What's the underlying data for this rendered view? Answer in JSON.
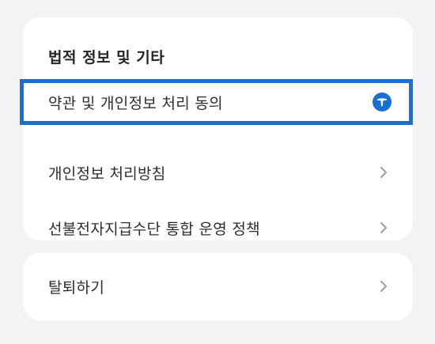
{
  "section": {
    "title": "법적 정보 및 기타"
  },
  "items": [
    {
      "label": "약관 및 개인정보 처리 동의",
      "icon": "toss-logo-icon"
    },
    {
      "label": "개인정보 처리방침",
      "icon": "chevron-right-icon"
    },
    {
      "label": "선불전자지급수단 통합 운영 정책",
      "icon": "chevron-right-icon"
    }
  ],
  "withdraw": {
    "label": "탈퇴하기",
    "icon": "chevron-right-icon"
  },
  "colors": {
    "background": "#f2f3f5",
    "card": "#ffffff",
    "focus_border": "#1a6fd4",
    "brand_blue": "#1a6fd4",
    "chevron": "#9aa0a8"
  }
}
